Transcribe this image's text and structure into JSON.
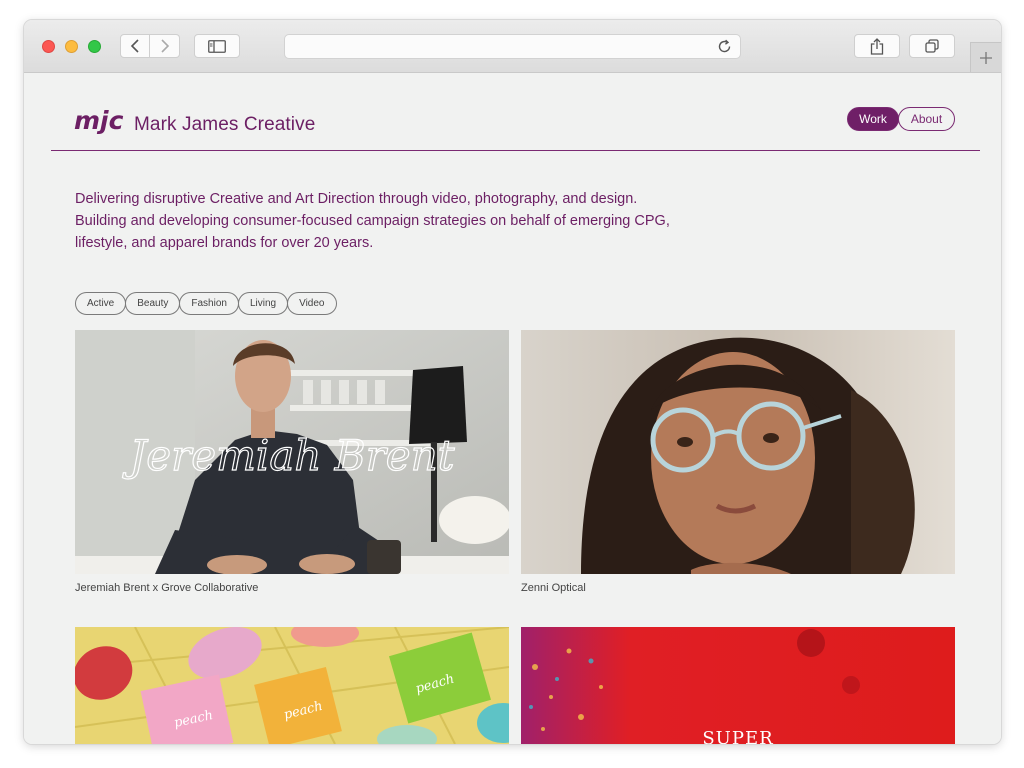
{
  "browser": {
    "address_value": "",
    "controls": [
      "back-icon",
      "forward-icon",
      "sidebar-icon",
      "reload-icon",
      "share-icon",
      "tabs-icon",
      "plus-icon"
    ]
  },
  "site": {
    "logo_text": "mjc",
    "title": "Mark James Creative",
    "brand_color": "#6c1f64"
  },
  "nav": {
    "work_label": "Work",
    "about_label": "About",
    "active": "Work"
  },
  "intro": {
    "text": "Delivering disruptive Creative and Art Direction through video, photography, and design. Building and developing consumer-focused campaign strategies on behalf of emerging CPG, lifestyle, and apparel brands for over 20 years."
  },
  "filters": [
    "Active",
    "Beauty",
    "Fashion",
    "Living",
    "Video"
  ],
  "projects": [
    {
      "caption": "Jeremiah Brent x Grove Collaborative",
      "overlay_script": "Jeremiah Brent"
    },
    {
      "caption": "Zenni Optical"
    },
    {
      "caption": "",
      "product_text": "peach"
    },
    {
      "caption": "",
      "headline": "SUPER"
    }
  ]
}
